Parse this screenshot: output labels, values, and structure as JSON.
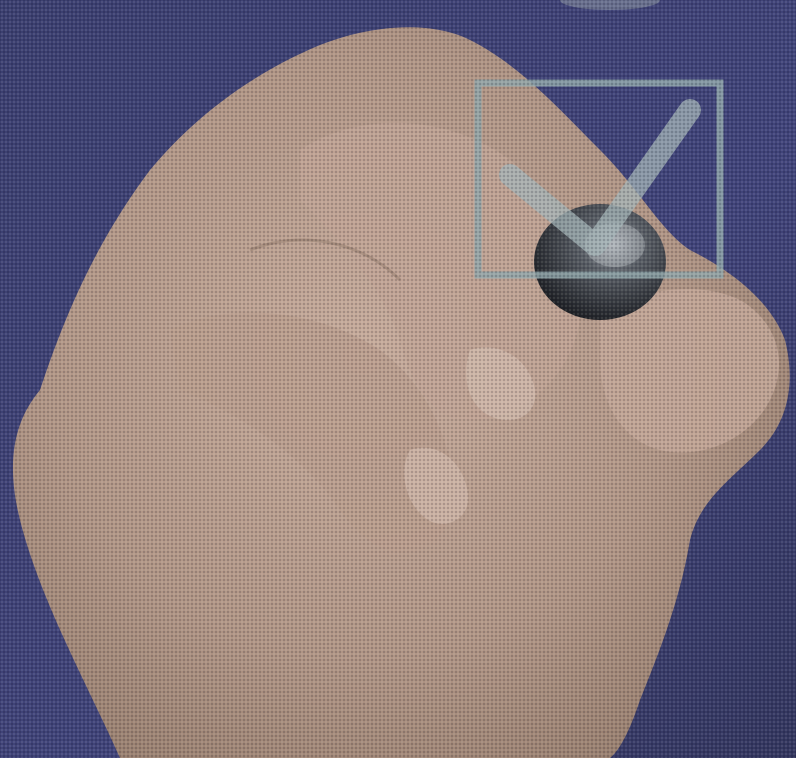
{
  "scene": {
    "description_icon": "hand-holding-pen-checkbox",
    "colors": {
      "background": "#3a3d6b",
      "background_light": "#464a7c",
      "skin": "#b49a8a",
      "skin_shadow": "#8f7868",
      "skin_highlight": "#cdb4a4",
      "checkbox_stroke": "#8fa4a8",
      "pen_dark": "#222428",
      "pen_light": "#9aa0a6"
    },
    "icons": {
      "checkbox": "checkbox-icon",
      "checkmark": "checkmark-icon",
      "pen": "pen-icon",
      "hand": "hand-icon"
    }
  }
}
